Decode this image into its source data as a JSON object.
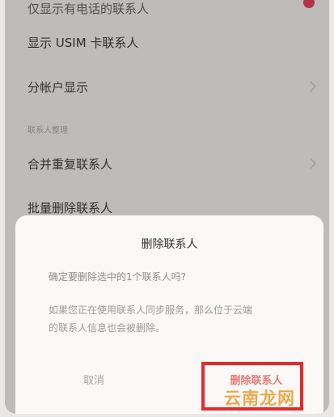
{
  "settings": {
    "top_item": "仅显示有电话的联系人",
    "usim_item": "显示 USIM 卡联系人",
    "account_item": "分帐户显示",
    "section_header": "联系人整理",
    "merge_item": "合并重复联系人",
    "batch_delete_item": "批量删除联系人"
  },
  "dialog": {
    "title": "删除联系人",
    "message": "确定要删除选中的1个联系人吗?",
    "note_line1": "如果您正在使用联系人同步服务，那么位于云端",
    "note_line2": "的联系人信息也会被删除。",
    "cancel_label": "取消",
    "delete_label": "删除联系人"
  },
  "watermark": "云南龙网",
  "colors": {
    "accent": "#e0455a",
    "highlight": "#e52a2a",
    "watermark": "#f0a64a"
  }
}
